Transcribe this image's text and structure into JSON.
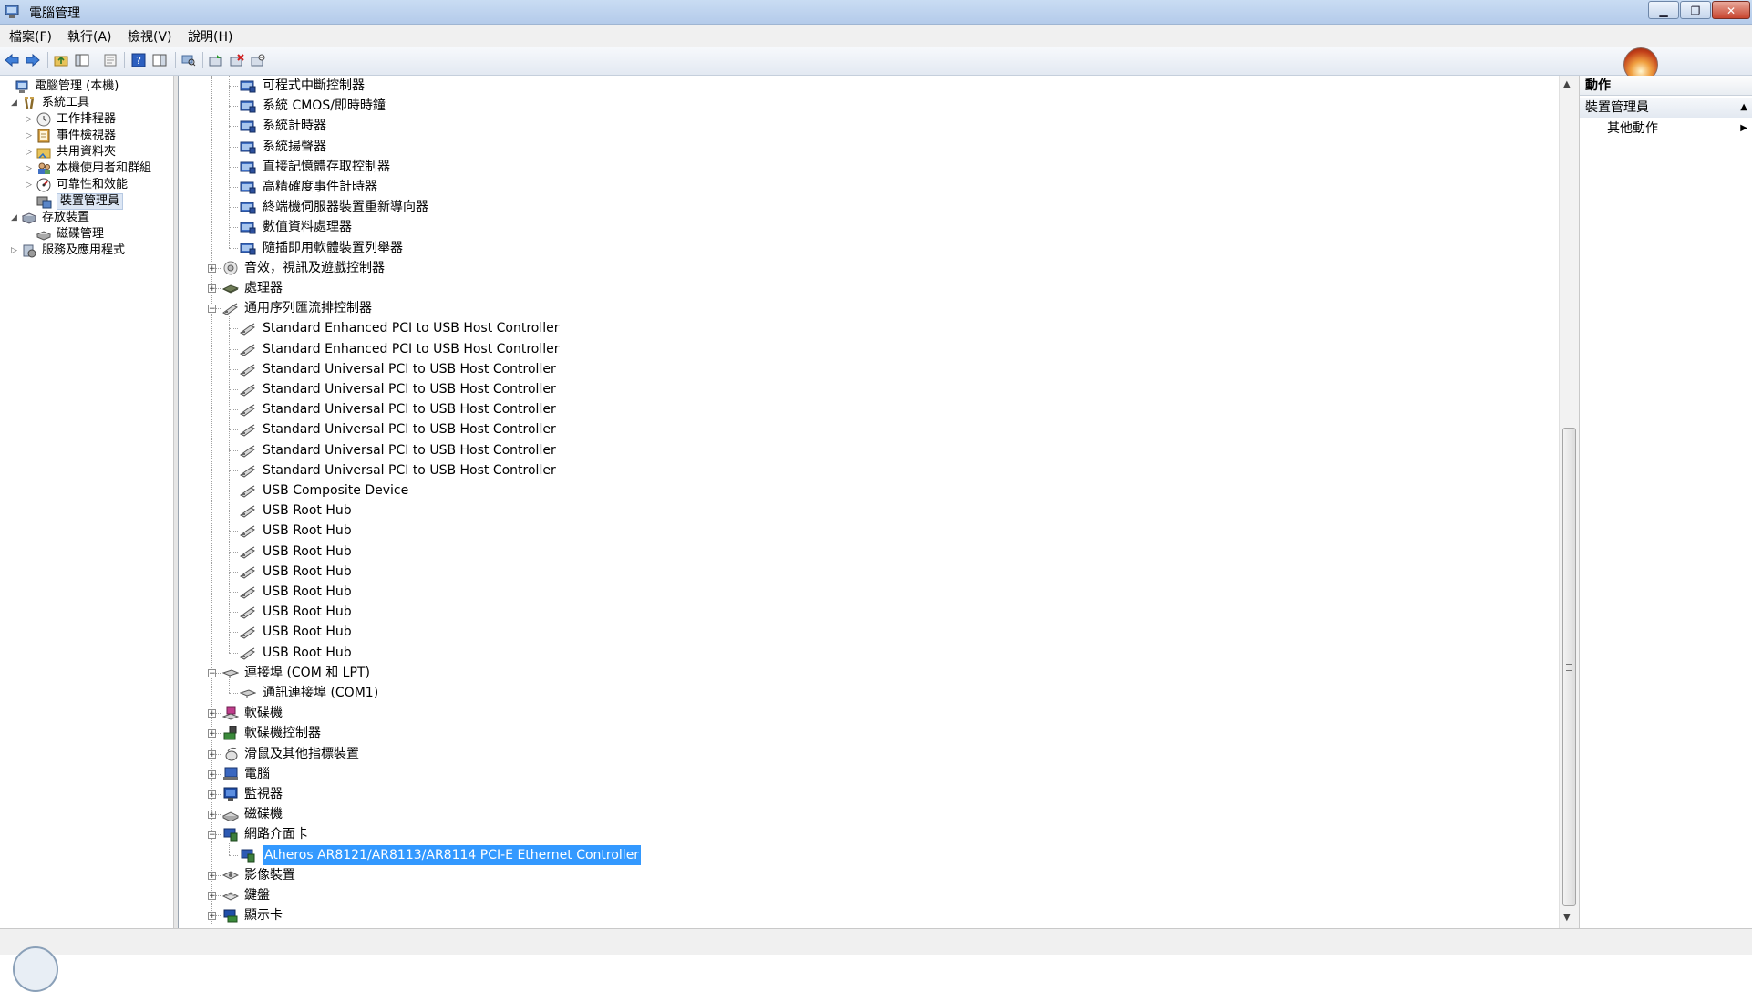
{
  "window": {
    "title": "電腦管理",
    "buttons": {
      "minimize": "▁",
      "maximize": "❐",
      "close": "✕"
    }
  },
  "menu": [
    "檔案(F)",
    "執行(A)",
    "檢視(V)",
    "說明(H)"
  ],
  "toolbar": {
    "icons": [
      "back-icon",
      "forward-icon",
      "up-folder-icon",
      "console-tree-icon",
      "properties-icon",
      "help-icon",
      "show-hide-icon",
      "scan-icon",
      "update-driver-icon",
      "uninstall-icon",
      "disable-icon"
    ]
  },
  "left_tree": [
    {
      "label": "電腦管理 (本機)",
      "level": 0,
      "expander": "none",
      "icon": "computer-management-icon"
    },
    {
      "label": "系統工具",
      "level": 1,
      "expander": "open",
      "icon": "tools-icon"
    },
    {
      "label": "工作排程器",
      "level": 2,
      "expander": "closed",
      "icon": "clock-icon"
    },
    {
      "label": "事件檢視器",
      "level": 2,
      "expander": "closed",
      "icon": "event-viewer-icon"
    },
    {
      "label": "共用資料夾",
      "level": 2,
      "expander": "closed",
      "icon": "shared-folder-icon"
    },
    {
      "label": "本機使用者和群組",
      "level": 2,
      "expander": "closed",
      "icon": "users-icon"
    },
    {
      "label": "可靠性和效能",
      "level": 2,
      "expander": "closed",
      "icon": "performance-icon"
    },
    {
      "label": "裝置管理員",
      "level": 2,
      "expander": "none",
      "icon": "device-manager-icon",
      "selected": true
    },
    {
      "label": "存放裝置",
      "level": 1,
      "expander": "open",
      "icon": "storage-icon"
    },
    {
      "label": "磁碟管理",
      "level": 2,
      "expander": "none",
      "icon": "disk-management-icon"
    },
    {
      "label": "服務及應用程式",
      "level": 1,
      "expander": "closed",
      "icon": "services-icon"
    }
  ],
  "device_tree": [
    {
      "label": "可程式中斷控制器",
      "level": 2,
      "icon": "system-device-icon"
    },
    {
      "label": "系統 CMOS/即時時鐘",
      "level": 2,
      "icon": "system-device-icon"
    },
    {
      "label": "系統計時器",
      "level": 2,
      "icon": "system-device-icon"
    },
    {
      "label": "系統揚聲器",
      "level": 2,
      "icon": "system-device-icon"
    },
    {
      "label": "直接記憶體存取控制器",
      "level": 2,
      "icon": "system-device-icon"
    },
    {
      "label": "高精確度事件計時器",
      "level": 2,
      "icon": "system-device-icon"
    },
    {
      "label": "終端機伺服器裝置重新導向器",
      "level": 2,
      "icon": "system-device-icon"
    },
    {
      "label": "數值資料處理器",
      "level": 2,
      "icon": "system-device-icon"
    },
    {
      "label": "隨插即用軟體裝置列舉器",
      "level": 2,
      "icon": "system-device-icon"
    },
    {
      "label": "音效，視訊及遊戲控制器",
      "level": 1,
      "expander": "+",
      "icon": "sound-icon"
    },
    {
      "label": "處理器",
      "level": 1,
      "expander": "+",
      "icon": "processor-icon"
    },
    {
      "label": "通用序列匯流排控制器",
      "level": 1,
      "expander": "−",
      "icon": "usb-icon"
    },
    {
      "label": "Standard Enhanced PCI to USB Host Controller",
      "level": 2,
      "icon": "usb-icon"
    },
    {
      "label": "Standard Enhanced PCI to USB Host Controller",
      "level": 2,
      "icon": "usb-icon"
    },
    {
      "label": "Standard Universal PCI to USB Host Controller",
      "level": 2,
      "icon": "usb-icon"
    },
    {
      "label": "Standard Universal PCI to USB Host Controller",
      "level": 2,
      "icon": "usb-icon"
    },
    {
      "label": "Standard Universal PCI to USB Host Controller",
      "level": 2,
      "icon": "usb-icon"
    },
    {
      "label": "Standard Universal PCI to USB Host Controller",
      "level": 2,
      "icon": "usb-icon"
    },
    {
      "label": "Standard Universal PCI to USB Host Controller",
      "level": 2,
      "icon": "usb-icon"
    },
    {
      "label": "Standard Universal PCI to USB Host Controller",
      "level": 2,
      "icon": "usb-icon"
    },
    {
      "label": "USB Composite Device",
      "level": 2,
      "icon": "usb-icon"
    },
    {
      "label": "USB Root Hub",
      "level": 2,
      "icon": "usb-icon"
    },
    {
      "label": "USB Root Hub",
      "level": 2,
      "icon": "usb-icon"
    },
    {
      "label": "USB Root Hub",
      "level": 2,
      "icon": "usb-icon"
    },
    {
      "label": "USB Root Hub",
      "level": 2,
      "icon": "usb-icon"
    },
    {
      "label": "USB Root Hub",
      "level": 2,
      "icon": "usb-icon"
    },
    {
      "label": "USB Root Hub",
      "level": 2,
      "icon": "usb-icon"
    },
    {
      "label": "USB Root Hub",
      "level": 2,
      "icon": "usb-icon"
    },
    {
      "label": "USB Root Hub",
      "level": 2,
      "icon": "usb-icon"
    },
    {
      "label": "連接埠 (COM 和 LPT)",
      "level": 1,
      "expander": "−",
      "icon": "port-icon"
    },
    {
      "label": "通訊連接埠 (COM1)",
      "level": 2,
      "icon": "port-icon"
    },
    {
      "label": "軟碟機",
      "level": 1,
      "expander": "+",
      "icon": "floppy-drive-icon"
    },
    {
      "label": "軟碟機控制器",
      "level": 1,
      "expander": "+",
      "icon": "floppy-controller-icon"
    },
    {
      "label": "滑鼠及其他指標裝置",
      "level": 1,
      "expander": "+",
      "icon": "mouse-icon"
    },
    {
      "label": "電腦",
      "level": 1,
      "expander": "+",
      "icon": "computer-icon"
    },
    {
      "label": "監視器",
      "level": 1,
      "expander": "+",
      "icon": "monitor-icon"
    },
    {
      "label": "磁碟機",
      "level": 1,
      "expander": "+",
      "icon": "disk-drive-icon"
    },
    {
      "label": "網路介面卡",
      "level": 1,
      "expander": "−",
      "icon": "network-adapter-icon"
    },
    {
      "label": "Atheros AR8121/AR8113/AR8114 PCI-E Ethernet Controller",
      "level": 2,
      "icon": "network-adapter-icon",
      "selected": true
    },
    {
      "label": "影像裝置",
      "level": 1,
      "expander": "+",
      "icon": "imaging-device-icon"
    },
    {
      "label": "鍵盤",
      "level": 1,
      "expander": "+",
      "icon": "keyboard-icon"
    },
    {
      "label": "顯示卡",
      "level": 1,
      "expander": "+",
      "icon": "display-adapter-icon"
    }
  ],
  "actions": {
    "header": "動作",
    "section": "裝置管理員",
    "more": "其他動作"
  },
  "colors": {
    "selection": "#3399ff",
    "titlebar": "#c9dcf3"
  }
}
